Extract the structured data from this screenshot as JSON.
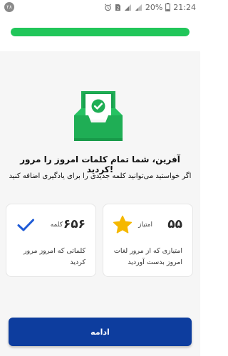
{
  "status_bar": {
    "notification_badge": "۲۸",
    "battery_percent": "20%",
    "time": "21:24"
  },
  "progress": {
    "value": 1.0,
    "fill_color": "#21c65a",
    "track_color": "#d9f5e3"
  },
  "completion": {
    "illustration_icon": "inbox-check-icon",
    "title": "آفرین، شما تمام کلمات امروز را مرور کردید!",
    "subtitle": "اگر خواستید می‌توانید کلمه جدیدی را برای یادگیری اضافه کنید"
  },
  "stats": [
    {
      "number": "۵۵",
      "unit": "امتیاز",
      "description": "امتیازی که از مرور لغات امروز بدست آوردید",
      "icon": "star-icon",
      "icon_color": "#f5b800"
    },
    {
      "number": "۶۵۶",
      "unit": "کلمه",
      "description": "کلماتی که امروز مرور کردید",
      "icon": "checkmark-icon",
      "icon_color": "#1f5bd6"
    }
  ],
  "continue_button": {
    "label": "ادامه",
    "color": "#0d3d9e"
  }
}
